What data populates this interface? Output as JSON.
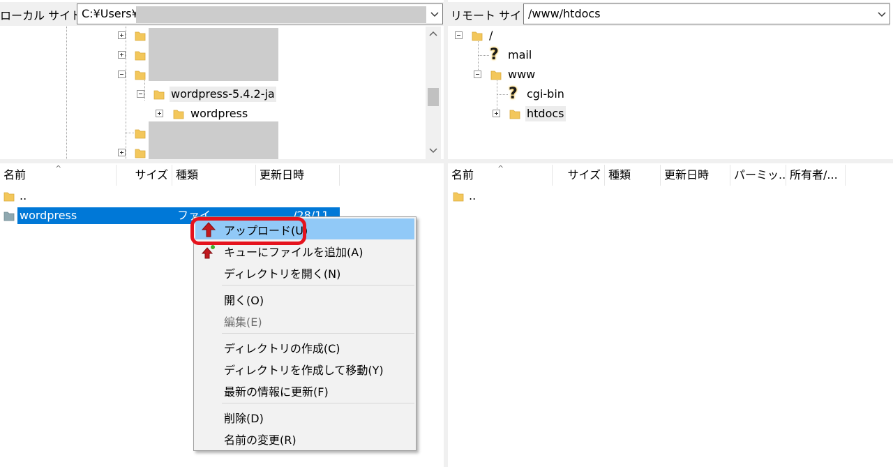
{
  "local_site": {
    "label": "ローカル サイト:",
    "path": "C:¥Users¥"
  },
  "remote_site": {
    "label": "リモート サイト:",
    "path": "/www/htdocs"
  },
  "local_tree": {
    "items": [
      {
        "label": "wordpress-5.4.2-ja"
      },
      {
        "label": "wordpress"
      }
    ]
  },
  "remote_tree": {
    "items": [
      {
        "label": "/"
      },
      {
        "label": "mail"
      },
      {
        "label": "www"
      },
      {
        "label": "cgi-bin"
      },
      {
        "label": "htdocs"
      }
    ]
  },
  "local_list": {
    "columns": [
      "名前",
      "サイズ",
      "種類",
      "更新日時"
    ],
    "rows": [
      {
        "name": ".."
      },
      {
        "name": "wordpress",
        "type_partial": "ファイ",
        "date_partial": "/28/11"
      }
    ]
  },
  "remote_list": {
    "columns": [
      "名前",
      "サイズ",
      "種類",
      "更新日時",
      "パーミッ...",
      "所有者/..."
    ],
    "rows": [
      {
        "name": ".."
      }
    ]
  },
  "context_menu": {
    "items": [
      {
        "label": "アップロード(U)",
        "highlighted": true
      },
      {
        "label": "キューにファイルを追加(A)"
      },
      {
        "label": "ディレクトリを開く(N)"
      },
      {
        "label": "開く(O)"
      },
      {
        "label": "編集(E)",
        "disabled": true
      },
      {
        "label": "ディレクトリの作成(C)"
      },
      {
        "label": "ディレクトリを作成して移動(Y)"
      },
      {
        "label": "最新の情報に更新(F)"
      },
      {
        "label": "削除(D)"
      },
      {
        "label": "名前の変更(R)"
      }
    ]
  },
  "colors": {
    "selection": "#0078d7",
    "menu_highlight": "#91c9f7",
    "callout_ring": "#e5131d",
    "folder": "#f3c75b"
  }
}
